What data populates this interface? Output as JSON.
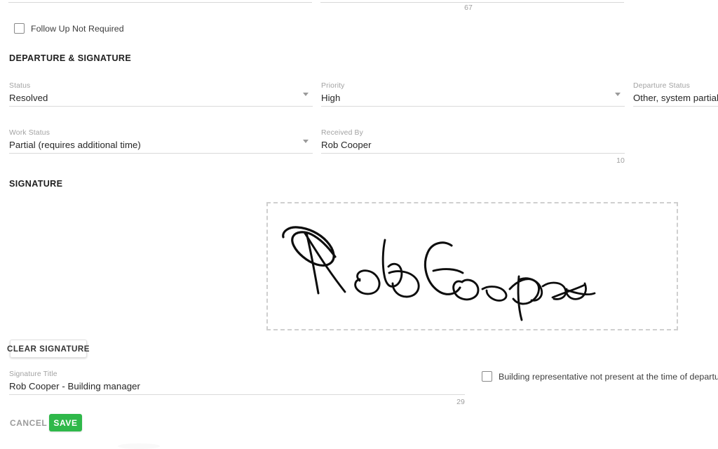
{
  "top_overflow": {
    "counter": "67"
  },
  "follow_up": {
    "label": "Follow Up Not Required",
    "checked": false,
    "icon": "checkbox-unchecked-icon"
  },
  "departure_section": {
    "title": "DEPARTURE & SIGNATURE",
    "fields": [
      {
        "name": "status",
        "label": "Status",
        "value": "Resolved",
        "type": "select",
        "icon": "chevron-down-icon"
      },
      {
        "name": "priority",
        "label": "Priority",
        "value": "High",
        "type": "select",
        "icon": "chevron-down-icon"
      },
      {
        "name": "departure-status",
        "label": "Departure Status",
        "value": "Other, system partially ope",
        "type": "select"
      },
      {
        "name": "work-status",
        "label": "Work Status",
        "value": "Partial (requires additional time)",
        "type": "select",
        "icon": "chevron-down-icon"
      },
      {
        "name": "received-by",
        "label": "Received By",
        "value": "Rob Cooper",
        "type": "text",
        "counter": "10"
      }
    ]
  },
  "signature_section": {
    "title": "SIGNATURE",
    "canvas_name": "signature-canvas",
    "signature_text": "Rob Cooper",
    "clear_button": "CLEAR SIGNATURE",
    "title_field": {
      "label": "Signature Title",
      "value": "Rob Cooper - Building manager",
      "counter": "29"
    },
    "rep_absent_checkbox": {
      "label": "Building representative not present at the time of departure",
      "checked": false,
      "icon": "checkbox-unchecked-icon"
    }
  },
  "footer": {
    "cancel_label": "CANCEL",
    "save_label": "SAVE",
    "save_color": "#2fb84a"
  }
}
